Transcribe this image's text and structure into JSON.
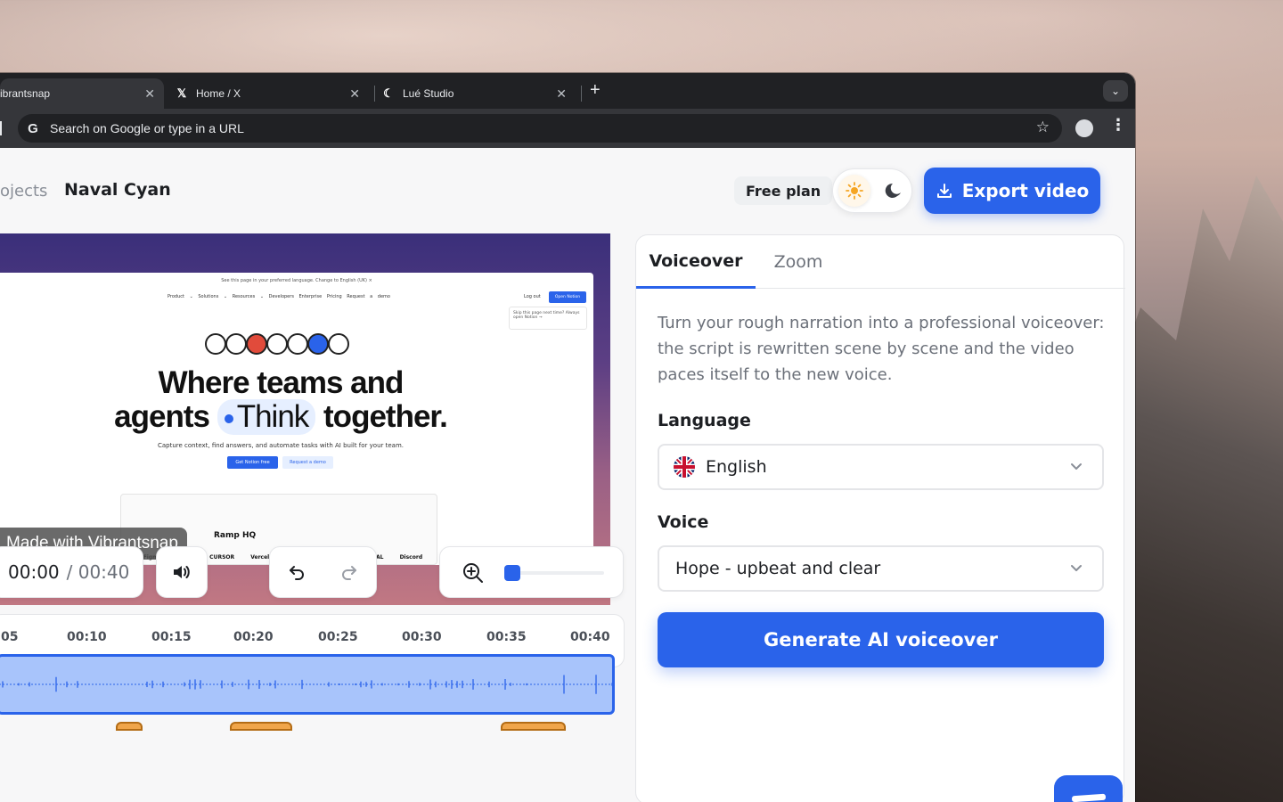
{
  "browser": {
    "tabs": [
      {
        "label": "ibrantsnap",
        "icon": "vibrantsnap-icon"
      },
      {
        "label": "Home / X",
        "icon": "x-logo-icon"
      },
      {
        "label": "Lué Studio",
        "icon": "moon-icon"
      }
    ],
    "omnibox_placeholder": "Search on Google or type in a URL"
  },
  "header": {
    "breadcrumb_projects": "ojects",
    "project_title": "Naval Cyan",
    "free_plan": "Free plan",
    "export_label": "Export video"
  },
  "preview": {
    "banner": "See this page in your preferred language.  Change to English (UK)  ×",
    "nav": "Product ⌄ Solutions ⌄ Resources ⌄ Developers Enterprise Pricing Request a demo",
    "logout": "Log out",
    "get_notion": "Open Notion",
    "popup": "Skip this page next time?  Always open Notion →",
    "headline_1": "Where teams and",
    "headline_2a": "agents",
    "headline_think": "Think",
    "headline_2b": "together.",
    "sub": "Capture context, find answers, and automate tasks with AI built for your team.",
    "cta_primary": "Get Notion free",
    "cta_secondary": "Request a demo",
    "ramp": "Ramp HQ",
    "logos": "OpenAI Figma ramp CURSOR Vercel NVIDIA VOLVO L'ORÉAL Discord",
    "watermark": "Made with Vibrantsnap"
  },
  "player": {
    "current_time": "00:00",
    "total_time": "/ 00:40",
    "zoom_level": 0.0
  },
  "timeline": {
    "ticks": [
      "05",
      "00:10",
      "00:15",
      "00:20",
      "00:25",
      "00:30",
      "00:35",
      "00:40"
    ]
  },
  "panel": {
    "tab_voiceover": "Voiceover",
    "tab_zoom": "Zoom",
    "description": "Turn your rough narration into a professional voiceover: the script is rewritten scene by scene and the video paces itself to the new voice.",
    "language_label": "Language",
    "language_value": "English",
    "voice_label": "Voice",
    "voice_value": "Hope - upbeat and clear",
    "generate_label": "Generate AI voiceover"
  },
  "colors": {
    "accent": "#2a63ea",
    "wave_fill": "#a8c4fb"
  }
}
